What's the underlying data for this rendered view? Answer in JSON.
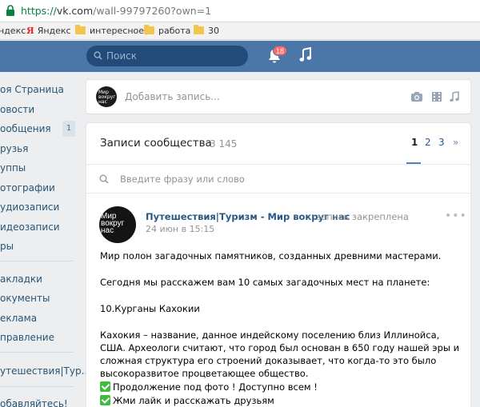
{
  "browser": {
    "url_scheme": "https://",
    "url_rest_bold": "vk.com",
    "url_rest": "/wall-99797260?own=1"
  },
  "bookmarks": [
    {
      "label": "ндекс",
      "type": "text"
    },
    {
      "label": "Яндекс",
      "type": "yandex"
    },
    {
      "label": "интересное",
      "type": "folder"
    },
    {
      "label": "работа",
      "type": "folder"
    },
    {
      "label": "30",
      "type": "folder"
    }
  ],
  "header": {
    "search_placeholder": "Поиск",
    "notifications_count": "18"
  },
  "left_menu": {
    "items": [
      "оя Страница",
      "овости",
      "ообщения",
      "рузья",
      "уппы",
      "отографии",
      "удиозаписи",
      "идеозаписи",
      "ры",
      "акладки",
      "окументы",
      "еклама",
      "правление",
      "утешествия|Тур..",
      "обавляйтесь!"
    ],
    "messages_count": "1"
  },
  "composer": {
    "placeholder": "Добавить запись...",
    "avatar_text": "Мир вокруг нас"
  },
  "wall": {
    "title": "Записи сообщества",
    "count": "3 145",
    "pages": [
      "1",
      "2",
      "3",
      "»"
    ],
    "search_placeholder": "Введите фразу или слово"
  },
  "post": {
    "avatar_text": "Мир вокруг нас",
    "author": "Путешествия|Туризм - Мир вокруг нас",
    "pinned": "запись закреплена",
    "date": "24 июн в 15:15",
    "p1": "Мир полон загадочных памятников, созданных древними мастерами.",
    "p2": "Сегодня мы расскажем вам 10 самых загадочных мест на планете:",
    "p3": "10.Курганы Кахокии",
    "p4": "Кахокия – название, данное индейскому поселению близ Иллинойса, США. Археологи считают, что город был основан в 650 году нашей эры и сложная структура его строений доказывает, что когда-то это было высокоразвитое процветающее общество.",
    "l1": "Продолжение под фото ! Доступно всем !",
    "l2": "Жми лайк и расскажать друзьям"
  }
}
